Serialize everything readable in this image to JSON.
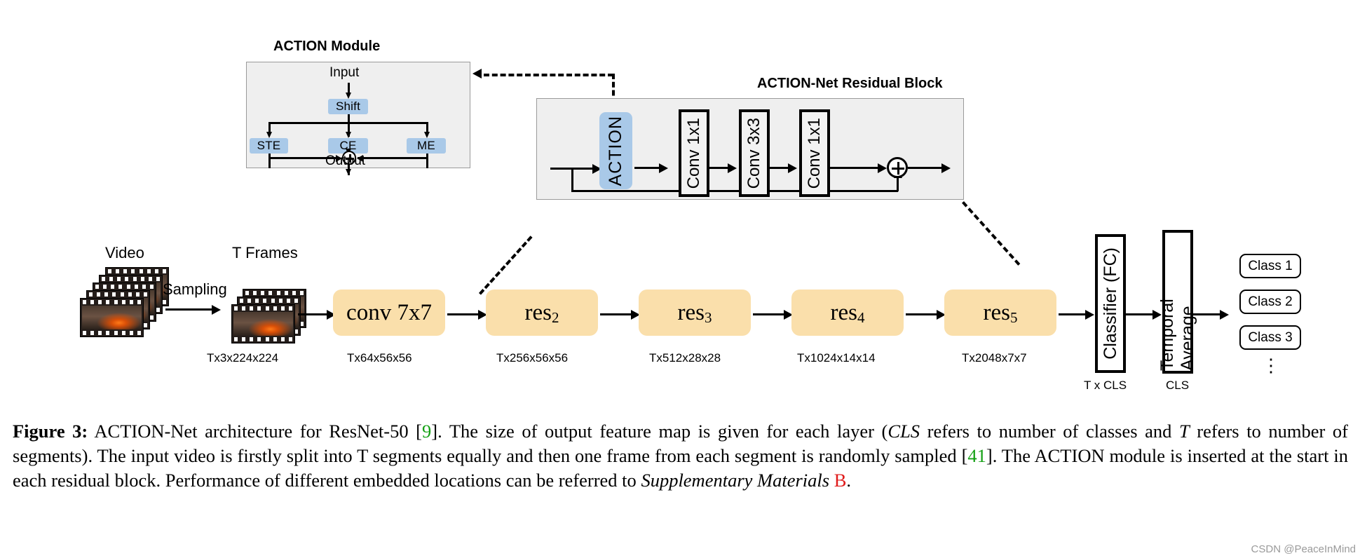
{
  "figure": {
    "number": "Figure 3:",
    "watermark": "CSDN @PeaceInMind"
  },
  "action_module": {
    "title": "ACTION Module",
    "input_label": "Input",
    "output_label": "Output",
    "shift_label": "Shift",
    "branches": [
      "STE",
      "CE",
      "ME"
    ],
    "sum_symbol": "+",
    "panel_bg": "#efefef",
    "chip_color": "#a9c9e8"
  },
  "residual_block": {
    "title": "ACTION-Net Residual Block",
    "action_label": "ACTION",
    "convs": [
      "Conv 1x1",
      "Conv 3x3",
      "Conv 1x1"
    ],
    "sum_symbol": "+",
    "panel_bg": "#efefef",
    "chip_color": "#a9c9e8"
  },
  "pipeline": {
    "video_label": "Video",
    "frames_label": "T Frames",
    "sampling_label": "Sampling",
    "stages": [
      {
        "name": "conv 7x7",
        "sub": "",
        "dims": "Tx64x56x56"
      },
      {
        "name": "res",
        "sub": "2",
        "dims": "Tx256x56x56"
      },
      {
        "name": "res",
        "sub": "3",
        "dims": "Tx512x28x28"
      },
      {
        "name": "res",
        "sub": "4",
        "dims": "Tx1024x14x14"
      },
      {
        "name": "res",
        "sub": "5",
        "dims": "Tx2048x7x7"
      }
    ],
    "frames_dims": "Tx3x224x224",
    "stage_color": "#fadfab"
  },
  "head": {
    "classifier_label": "Classifier (FC)",
    "classifier_dims": "T x CLS",
    "temporal_average_label": "Temporal Average",
    "temporal_average_dims": "CLS",
    "classes": [
      "Class 1",
      "Class 2",
      "Class 3"
    ],
    "ellipsis": "⋮"
  },
  "caption": {
    "line1_a": "ACTION-Net architecture for ResNet-50 [",
    "ref1": "9",
    "line1_b": "].  The size of output feature map is given for each layer (",
    "math_cls": "CLS",
    "line1_c": " refers to number",
    "line2_a": "of classes and ",
    "math_t": "T",
    "line2_b": " refers to number of segments).  The input video is firstly split into T segments equally and then one frame from each",
    "line3_a": "segment is randomly sampled [",
    "ref2": "41",
    "line3_b": "]. The ACTION module is inserted at the start in each residual block. Performance of different embedded",
    "line4_a": "locations can be referred to ",
    "italic": "Supplementary Materials",
    "ref3": "B",
    "line4_b": "."
  }
}
